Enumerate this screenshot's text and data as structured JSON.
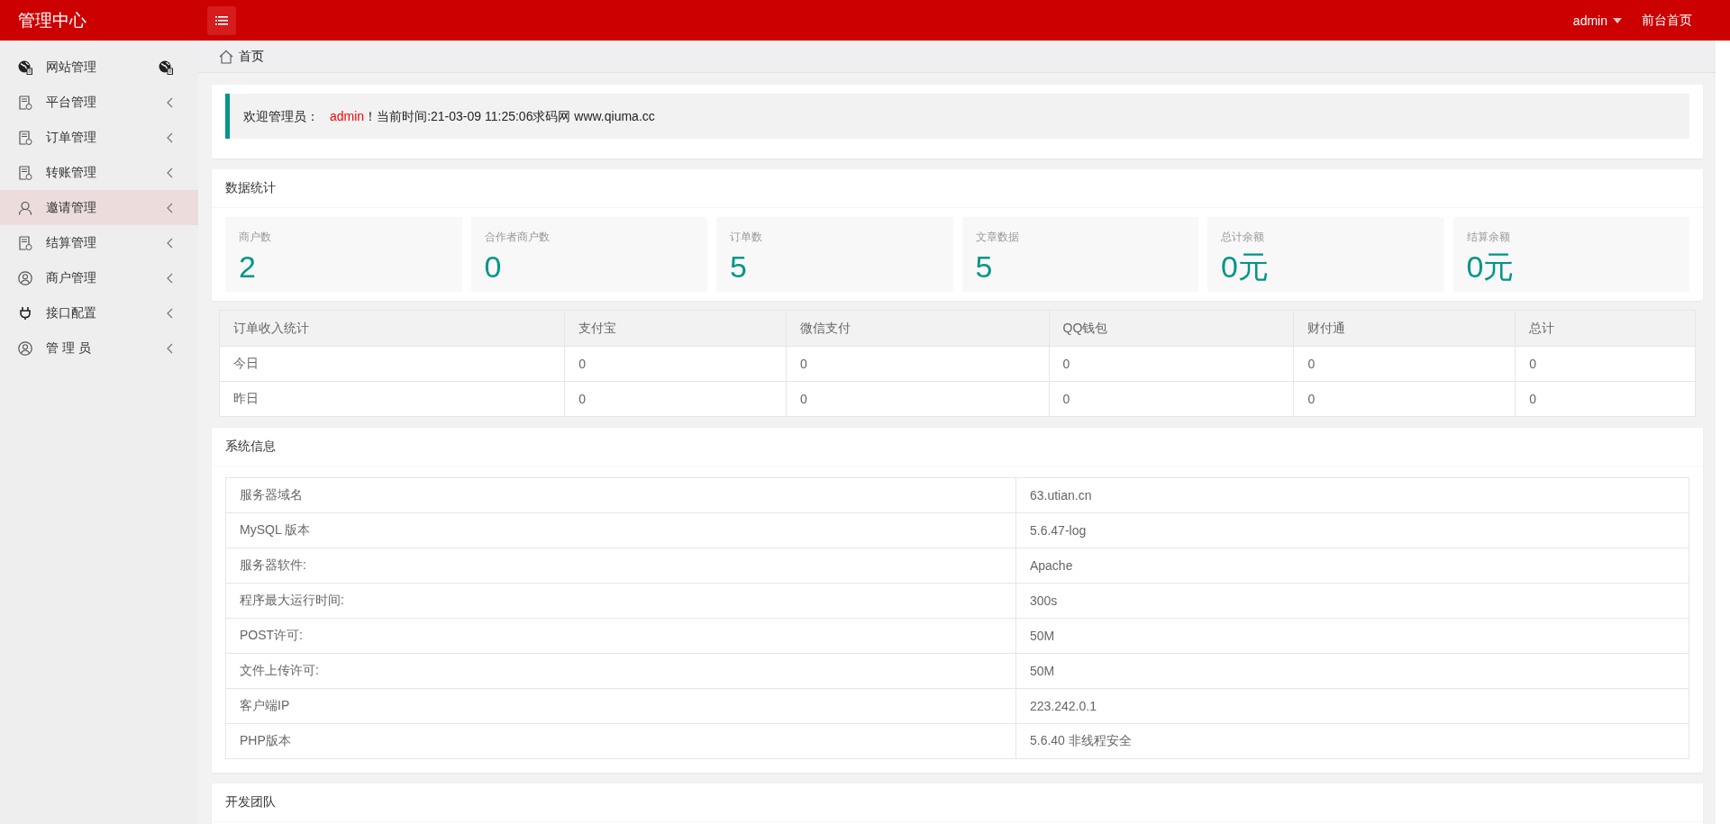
{
  "header": {
    "title": "管理中心",
    "user": "admin",
    "home_link": "前台首页"
  },
  "sidebar": {
    "items": [
      {
        "label": "网站管理",
        "kind": "globe",
        "selected": false,
        "has_submenu": false
      },
      {
        "label": "平台管理",
        "kind": "doc",
        "selected": false,
        "has_submenu": true
      },
      {
        "label": "订单管理",
        "kind": "doc",
        "selected": false,
        "has_submenu": true
      },
      {
        "label": "转账管理",
        "kind": "doc",
        "selected": false,
        "has_submenu": true
      },
      {
        "label": "邀请管理",
        "kind": "user",
        "selected": true,
        "has_submenu": true
      },
      {
        "label": "结算管理",
        "kind": "doc",
        "selected": false,
        "has_submenu": true
      },
      {
        "label": "商户管理",
        "kind": "user-circle",
        "selected": false,
        "has_submenu": true
      },
      {
        "label": "接口配置",
        "kind": "plug",
        "selected": false,
        "has_submenu": true
      },
      {
        "label": "管 理 员",
        "kind": "user-circle",
        "selected": false,
        "has_submenu": true
      }
    ]
  },
  "breadcrumb": "首页",
  "welcome": {
    "prefix": "欢迎管理员：",
    "user": "admin",
    "suffix": "！当前时间:21-03-09 11:25:06求码网 www.qiuma.cc"
  },
  "stats": {
    "title": "数据统计",
    "cards": [
      {
        "label": "商户数",
        "value": "2"
      },
      {
        "label": "合作者商户数",
        "value": "0"
      },
      {
        "label": "订单数",
        "value": "5"
      },
      {
        "label": "文章数据",
        "value": "5"
      },
      {
        "label": "总计余额",
        "value": "0元"
      },
      {
        "label": "结算余额",
        "value": "0元"
      }
    ]
  },
  "income_table": {
    "columns": [
      "订单收入统计",
      "支付宝",
      "微信支付",
      "QQ钱包",
      "财付通",
      "总计"
    ],
    "rows": [
      [
        "今日",
        "0",
        "0",
        "0",
        "0",
        "0"
      ],
      [
        "昨日",
        "0",
        "0",
        "0",
        "0",
        "0"
      ]
    ]
  },
  "system_info": {
    "title": "系统信息",
    "rows": [
      [
        "服务器域名",
        "63.utian.cn"
      ],
      [
        "MySQL 版本",
        "5.6.47-log"
      ],
      [
        "服务器软件:",
        "Apache"
      ],
      [
        "程序最大运行时间:",
        "300s"
      ],
      [
        "POST许可:",
        "50M"
      ],
      [
        "文件上传许可:",
        "50M"
      ],
      [
        "客户端IP",
        "223.242.0.1"
      ],
      [
        "PHP版本",
        "5.6.40 非线程安全"
      ]
    ]
  },
  "dev_team": {
    "title": "开发团队"
  }
}
